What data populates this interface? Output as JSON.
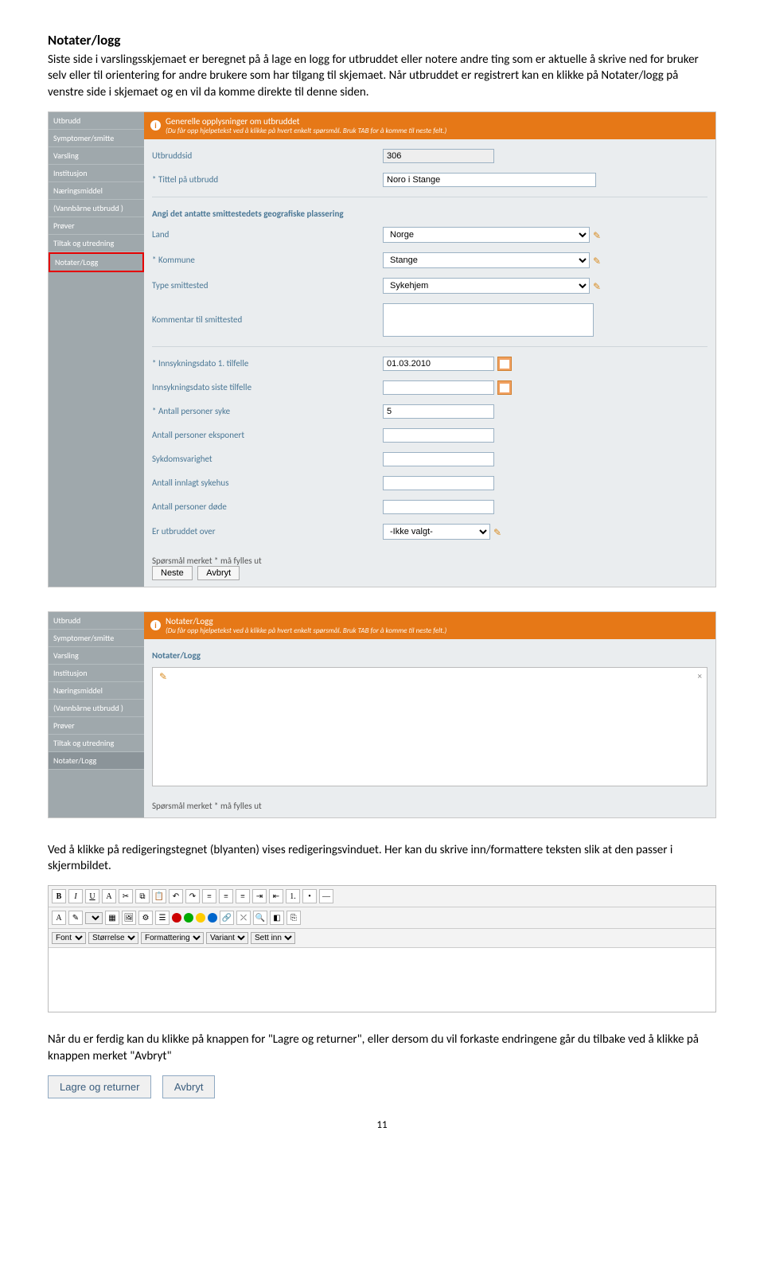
{
  "title": "Notater/logg",
  "intro": "Siste side i varslingsskjemaet er beregnet på å lage en logg for utbruddet eller notere andre ting som er aktuelle å skrive ned for bruker selv eller til orientering for andre brukere som har tilgang til skjemaet. Når utbruddet er registrert kan en klikke på Notater/logg på venstre side i skjemaet og en vil da komme direkte til denne siden.",
  "sidebar": [
    "Utbrudd",
    "Symptomer/smitte",
    "Varsling",
    "Institusjon",
    "Næringsmiddel",
    "(Vannbårne utbrudd )",
    "Prøver",
    "Tiltak og utredning",
    "Notater/Logg"
  ],
  "section1": {
    "title": "Generelle opplysninger om utbruddet",
    "hint": "(Du får opp hjelpetekst ved å klikke på hvert enkelt spørsmål. Bruk TAB for å komme til neste felt.)"
  },
  "fields": {
    "utbruddsid": {
      "label": "Utbruddsid",
      "value": "306"
    },
    "tittel": {
      "label": "* Tittel på utbrudd",
      "value": "Noro i Stange"
    },
    "geo": "Angi det antatte smittestedets geografiske plassering",
    "land": {
      "label": "Land",
      "value": "Norge"
    },
    "kommune": {
      "label": "* Kommune",
      "value": "Stange"
    },
    "type": {
      "label": "Type smittested",
      "value": "Sykehjem"
    },
    "kommentar": {
      "label": "Kommentar til smittested",
      "value": ""
    },
    "dato1": {
      "label": "* Innsykningsdato 1. tilfelle",
      "value": "01.03.2010"
    },
    "dato2": {
      "label": "Innsykningsdato siste tilfelle",
      "value": ""
    },
    "syke": {
      "label": "* Antall personer syke",
      "value": "5"
    },
    "eksp": {
      "label": "Antall personer eksponert",
      "value": ""
    },
    "varighet": {
      "label": "Sykdomsvarighet",
      "value": ""
    },
    "sykehus": {
      "label": "Antall innlagt sykehus",
      "value": ""
    },
    "dode": {
      "label": "Antall personer døde",
      "value": ""
    },
    "over": {
      "label": "Er utbruddet over",
      "value": "-Ikke valgt-"
    }
  },
  "reqnote": "Spørsmål merket * må fylles ut",
  "btn_next": "Neste",
  "btn_cancel": "Avbryt",
  "section2": {
    "title": "Notater/Logg",
    "hint": "(Du får opp hjelpetekst ved å klikke på hvert enkelt spørsmål. Bruk TAB for å komme til neste felt.)",
    "label": "Notater/Logg"
  },
  "mid": "Ved å klikke på redigeringstegnet (blyanten) vises redigeringsvinduet. Her kan du skrive inn/formattere teksten slik at den passer i skjermbildet.",
  "rte_selects": [
    "Font",
    "Størrelse",
    "Formattering",
    "Variant",
    "Sett inn"
  ],
  "outro": "Når du er ferdig kan du klikke på knappen for \"Lagre og returner\", eller dersom du vil forkaste endringene går du tilbake ved å klikke på knappen merket \"Avbryt\"",
  "btn_save": "Lagre og returner",
  "btn_cancel2": "Avbryt",
  "page": "11"
}
